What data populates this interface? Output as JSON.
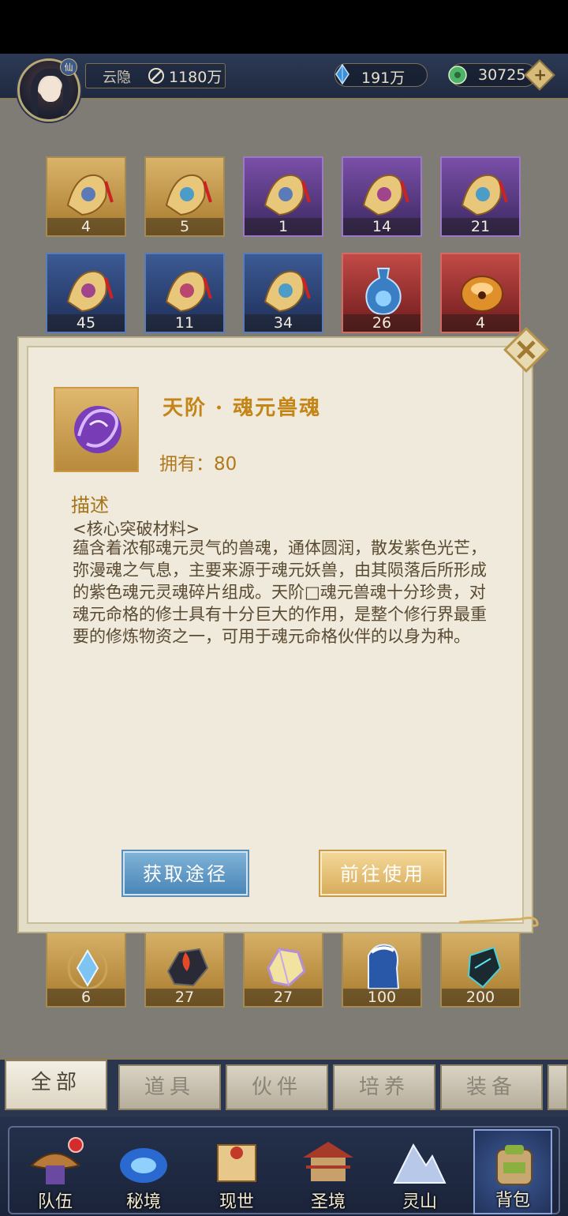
{
  "player": {
    "badge": "仙",
    "name": "云隐",
    "power": "1180万"
  },
  "resources": {
    "crystal": "191万",
    "jade": "30725",
    "plus_label": "+"
  },
  "inventory": {
    "row1": [
      {
        "count": "4",
        "quality": "gold"
      },
      {
        "count": "5",
        "quality": "gold"
      },
      {
        "count": "1",
        "quality": "purple"
      },
      {
        "count": "14",
        "quality": "purple"
      },
      {
        "count": "21",
        "quality": "purple"
      }
    ],
    "row2": [
      {
        "count": "45",
        "quality": "blue"
      },
      {
        "count": "11",
        "quality": "blue"
      },
      {
        "count": "34",
        "quality": "blue"
      },
      {
        "count": "26",
        "quality": "red"
      },
      {
        "count": "4",
        "quality": "red"
      }
    ],
    "row3": [
      {
        "count": "6"
      },
      {
        "count": "27"
      },
      {
        "count": "27"
      },
      {
        "count": "100"
      },
      {
        "count": "200"
      }
    ]
  },
  "detail": {
    "title": "天阶 · 魂元兽魂",
    "owned": "拥有：80",
    "desc_header": "描述",
    "desc_tag": "<核心突破材料>",
    "desc_body": "蕴含着浓郁魂元灵气的兽魂，通体圆润，散发紫色光芒，弥漫魂之气息，主要来源于魂元妖兽，由其陨落后所形成的紫色魂元灵魂碎片组成。天阶□魂元兽魂十分珍贵，对魂元命格的修士具有十分巨大的作用，是整个修行界最重要的修炼物资之一，可用于魂元命格伙伴的以身为种。",
    "btn_source": "获取途径",
    "btn_use": "前往使用"
  },
  "tabs": [
    "全部",
    "道具",
    "伙伴",
    "培养",
    "装备"
  ],
  "nav": [
    "队伍",
    "秘境",
    "现世",
    "圣境",
    "灵山",
    "背包"
  ]
}
